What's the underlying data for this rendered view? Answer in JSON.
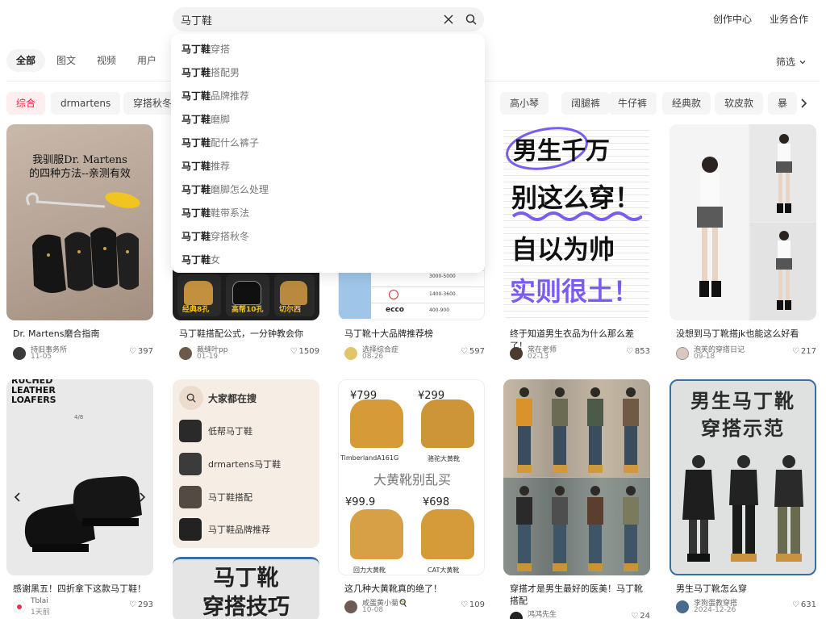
{
  "search": {
    "query": "马丁鞋"
  },
  "header": {
    "links": [
      "创作中心",
      "业务合作"
    ]
  },
  "tabs": [
    {
      "label": "全部",
      "active": true
    },
    {
      "label": "图文"
    },
    {
      "label": "视频"
    },
    {
      "label": "用户"
    }
  ],
  "filter_label": "筛选",
  "chips": [
    "综合",
    "drmartens",
    "穿搭秋冬",
    "高小琴",
    "阔腿裤",
    "牛仔裤",
    "经典款",
    "软皮款",
    "暴"
  ],
  "suggestions": [
    {
      "keyword": "马丁鞋",
      "rest": "穿搭"
    },
    {
      "keyword": "马丁鞋",
      "rest": "搭配男"
    },
    {
      "keyword": "马丁鞋",
      "rest": "品牌推荐"
    },
    {
      "keyword": "马丁鞋",
      "rest": "磨脚"
    },
    {
      "keyword": "马丁鞋",
      "rest": "配什么裤子"
    },
    {
      "keyword": "马丁鞋",
      "rest": "推荐"
    },
    {
      "keyword": "马丁鞋",
      "rest": "磨脚怎么处理"
    },
    {
      "keyword": "马丁鞋",
      "rest": "鞋带系法"
    },
    {
      "keyword": "马丁鞋",
      "rest": "穿搭秋冬"
    },
    {
      "keyword": "马丁鞋",
      "rest": "女"
    }
  ],
  "cards_row1": [
    {
      "title": "Dr. Martens磨合指南",
      "author": "持旧事务所",
      "date": "11-05",
      "likes": "397",
      "img_text": [
        "我驯服Dr. Martens",
        "的四种方法--亲测有效"
      ]
    },
    {
      "title": "马丁鞋搭配公式，一分钟教会你",
      "author": "裁缝叶pp",
      "date": "01-19",
      "likes": "1509",
      "img_text": [
        "经典8孔",
        "高帮10孔",
        "切尔西"
      ]
    },
    {
      "title": "马丁靴十大品牌推荐榜",
      "author": "选择综合症",
      "date": "08-26",
      "likes": "597",
      "img_text": [
        "3000-5000",
        "1400-3600",
        "400-900",
        "ecco"
      ]
    },
    {
      "title": "终于知道男生衣品为什么那么差了！",
      "author": "常在老师",
      "date": "02-13",
      "likes": "853",
      "img_text": [
        "男生千万",
        "别这么穿！",
        "自以为帅",
        "实则很土！"
      ]
    },
    {
      "title": "没想到马丁靴搭jk也能这么好看",
      "author": "泡芙的穿搭日记",
      "date": "09-18",
      "likes": "217"
    }
  ],
  "cards_row2": [
    {
      "title": "感谢黑五！四折拿下这款马丁鞋！",
      "author": "Tblai",
      "date": "1天前",
      "likes": "293",
      "img_text": [
        "RUCHED",
        "LEATHER",
        "LOAFERS",
        "4/8"
      ]
    },
    {
      "title": "这几种大黄靴真的绝了！",
      "author": "咸蛋黄小菊🍳",
      "date": "10-08",
      "likes": "109",
      "img_text": [
        "¥799",
        "¥299",
        "TimberlandA161G",
        "骆驼大黄靴",
        "大黄靴别乱买",
        "¥99.9",
        "¥698",
        "回力大黄靴",
        "CAT大黄靴"
      ]
    },
    {
      "title": "穿搭才是男生最好的医美！马丁靴搭配",
      "author": "鸿鸿先生",
      "date": "",
      "likes": "24"
    },
    {
      "title": "男生马丁靴怎么穿",
      "author": "李狗蛋教穿搭",
      "date": "2024-12-26",
      "likes": "631",
      "img_text": [
        "男生马丁靴",
        "穿搭示范"
      ]
    }
  ],
  "trending": {
    "title": "大家都在搜",
    "items": [
      "低帮马丁鞋",
      "drmartens马丁鞋",
      "马丁鞋搭配",
      "马丁鞋品牌推荐"
    ]
  },
  "bottom_card": {
    "img_text": [
      "马丁靴",
      "穿搭技巧"
    ]
  },
  "colors": {
    "accent": "#ff2442",
    "chip_bg": "#f5f5f5",
    "trend_bg": "#f6ede4"
  }
}
